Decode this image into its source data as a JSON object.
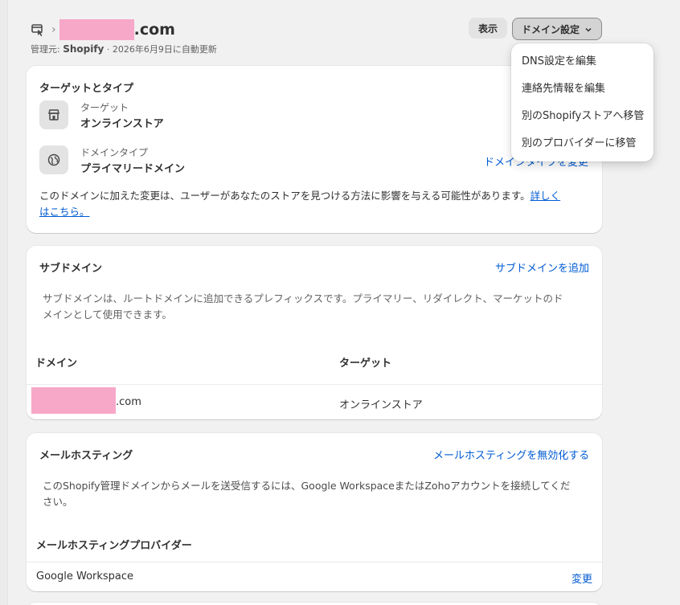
{
  "header": {
    "domain_suffix": ".com",
    "managed_by_prefix": "管理元: ",
    "managed_by": "Shopify",
    "renewal": " · 2026年6月9日に自動更新",
    "view_button": "表示",
    "settings_button": "ドメイン設定"
  },
  "dropdown": {
    "items": [
      "DNS設定を編集",
      "連絡先情報を編集",
      "別のShopifyストアへ移管",
      "別のプロバイダーに移管"
    ]
  },
  "target_card": {
    "title": "ターゲットとタイプ",
    "target_label": "ターゲット",
    "target_value": "オンラインストア",
    "type_label": "ドメインタイプ",
    "type_value": "プライマリードメイン",
    "change_type_link": "ドメインタイプを変更",
    "notice": "このドメインに加えた変更は、ユーザーがあなたのストアを見つける方法に影響を与える可能性があります。",
    "notice_link_1": "詳しく",
    "notice_link_2": "はこちら。"
  },
  "subdomain_card": {
    "title": "サブドメイン",
    "add_link": "サブドメインを追加",
    "description_line1": "サブドメインは、ルートドメインに追加できるプレフィックスです。プライマリー、リダイレクト、マーケットのド",
    "description_line2": "メインとして使用できます。",
    "columns": [
      "ドメイン",
      "ターゲット"
    ],
    "rows": [
      {
        "domain_suffix": ".com",
        "target": "オンラインストア"
      }
    ]
  },
  "mail_card": {
    "title": "メールホスティング",
    "disable_link": "メールホスティングを無効化する",
    "description_line1": "このShopify管理ドメインからメールを送受信するには、Google WorkspaceまたはZohoアカウントを接続してくだ",
    "description_line2": "さい。",
    "provider_header": "メールホスティングプロバイダー",
    "provider": "Google Workspace",
    "change_link": "変更"
  },
  "colors": {
    "link": "#005bd3",
    "redaction": "#f7a8c8",
    "background": "#f1f1f1"
  }
}
